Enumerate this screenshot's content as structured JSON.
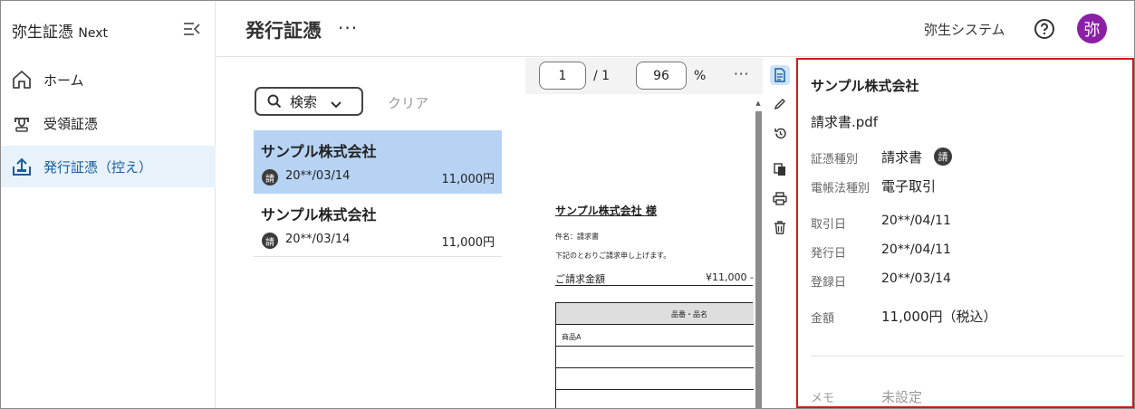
{
  "sidebar": {
    "brand": "弥生証憑",
    "brand_suffix": "Next",
    "items": [
      {
        "label": "ホーム",
        "icon": "home-icon"
      },
      {
        "label": "受領証憑",
        "icon": "inbox-icon"
      },
      {
        "label": "発行証憑（控え）",
        "icon": "upload-icon",
        "active": true
      }
    ]
  },
  "header": {
    "title": "発行証憑",
    "more": "···",
    "company": "弥生システム",
    "avatar": "弥"
  },
  "list": {
    "search_label": "検索",
    "clear_label": "クリア",
    "items": [
      {
        "name": "サンプル株式会社",
        "badge": "請",
        "date": "20**/03/14",
        "amount": "11,000円"
      },
      {
        "name": "サンプル株式会社",
        "badge": "請",
        "date": "20**/03/14",
        "amount": "11,000円"
      }
    ]
  },
  "viewer": {
    "page": "1",
    "page_total": "/ 1",
    "zoom": "96",
    "zoom_unit": "%",
    "more": "···"
  },
  "invoice": {
    "to": "サンプル株式会社 様",
    "subject": "件名：請求書",
    "message": "下記のとおりご請求申し上げます。",
    "total_label": "ご請求金額",
    "total_value": "¥11,000 -",
    "table_header": "品番・品名",
    "rows": [
      "商品A",
      "",
      "",
      ""
    ]
  },
  "details": {
    "title": "サンプル株式会社",
    "file": "請求書.pdf",
    "doc_type_label": "証憑種別",
    "doc_type_value": "請求書",
    "doc_type_badge": "請",
    "ledger_label": "電帳法種別",
    "ledger_value": "電子取引",
    "trade_date_label": "取引日",
    "trade_date_value": "20**/04/11",
    "issue_date_label": "発行日",
    "issue_date_value": "20**/04/11",
    "register_date_label": "登録日",
    "register_date_value": "20**/03/14",
    "amount_label": "金額",
    "amount_value": "11,000円（税込）",
    "memo_label": "メモ",
    "memo_value": "未設定"
  },
  "colors": {
    "accent": "#1a5da0",
    "selected_row": "#b7d3f3",
    "avatar": "#8b1fa6",
    "highlight_border": "#d61616"
  }
}
